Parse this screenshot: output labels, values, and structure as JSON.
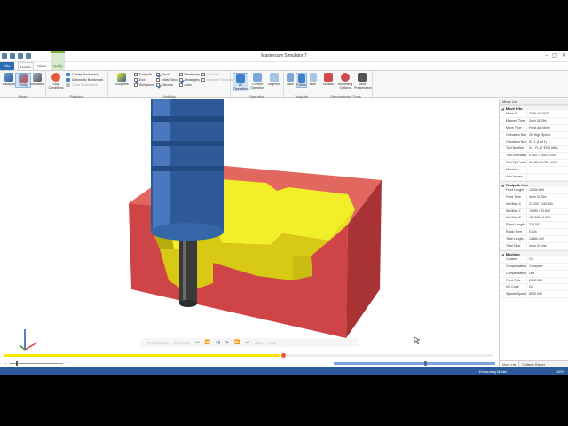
{
  "window": {
    "title": "Mastercam Simulator 7",
    "controls": [
      "–",
      "□",
      "✕"
    ]
  },
  "tabs": {
    "file": "File",
    "home": "Home",
    "view": "View",
    "verify": "Verify",
    "verify_context": "Verify"
  },
  "ribbon": {
    "mode": {
      "label": "Mode",
      "buttons": [
        {
          "name": "backplot",
          "label": "Backplot",
          "icon": "backplot-icon"
        },
        {
          "name": "verify",
          "label": "Verify",
          "icon": "verify-icon",
          "active": true
        },
        {
          "name": "simulation",
          "label": "Simulation",
          "icon": "simulation-icon"
        }
      ]
    },
    "playback": {
      "label": "Playback",
      "big_button": "Stop Conditions",
      "items": [
        "Create Bookmark",
        "Automatic Bookmark",
        "Clear Bookmarks"
      ]
    },
    "visibility": {
      "label": "Visibility",
      "big_button": "Toolpaths",
      "checks": [
        {
          "label": "Toolpath",
          "checked": false
        },
        {
          "label": "Tool",
          "checked": true
        },
        {
          "label": "Workpiece",
          "checked": false
        },
        {
          "label": "Stock",
          "checked": true
        },
        {
          "label": "Initial Stock",
          "checked": false
        },
        {
          "label": "Fixtures",
          "checked": true
        },
        {
          "label": "Wireframe",
          "checked": false
        },
        {
          "label": "Strategies",
          "checked": true
        },
        {
          "label": "Axes",
          "checked": false
        },
        {
          "label": "Machine",
          "checked": false,
          "dim": true
        },
        {
          "label": "Machine Housing",
          "checked": false,
          "dim": true
        }
      ]
    },
    "operation": {
      "label": "Operation",
      "buttons": [
        {
          "label": "All Operations",
          "active": true
        },
        {
          "label": "Current Operation"
        },
        {
          "label": "Segment"
        }
      ]
    },
    "toolpath": {
      "label": "Toolpath",
      "buttons": [
        {
          "label": "Trace"
        },
        {
          "label": "Follow",
          "active": true
        },
        {
          "label": "Both"
        }
      ]
    },
    "demonstrator": {
      "label": "Demonstrator Tools",
      "buttons": [
        {
          "label": "Session"
        },
        {
          "label": "Recording Options"
        },
        {
          "label": "Save Presentation"
        }
      ]
    }
  },
  "playback_overlay": {
    "buttons": [
      "Performance",
      "Precision",
      "⏮",
      "⏪",
      "▮▮",
      "▶",
      "⏩",
      "⏭",
      "Step",
      "Fast"
    ]
  },
  "progress": {
    "fraction": 0.57
  },
  "controls": {
    "slow": "—",
    "fast": "+"
  },
  "status": {
    "mode": "Enhancing Model",
    "percent": "100%"
  },
  "colors": {
    "stock": "#d04a4c",
    "machined": "#f2ee2a",
    "tool_holder": "#2f5a9a",
    "tool_shank": "#3a3a3a",
    "progress_fill": "#ffe600",
    "status_bar": "#2d5a9c"
  },
  "panel": {
    "title": "Move List",
    "sections": [
      {
        "title": "Move Info",
        "rows": [
          {
            "k": "Move ID",
            "v": "7296 of 10977"
          },
          {
            "k": "Elapsed Time",
            "v": "2min 36.39s"
          },
          {
            "k": "Move Type",
            "v": "Feed Arc Move"
          },
          {
            "k": "Operation Name",
            "v": "2D High Speed"
          },
          {
            "k": "Operation Numb",
            "v": "ID: 1 (1 of 1)"
          },
          {
            "k": "Tool Number",
            "v": "#1 - FLAT END MILL"
          },
          {
            "k": "Tool Orientation",
            "v": "0.000, 0.000, 1.000"
          },
          {
            "k": "Tool Tip Position",
            "v": "45.431, 5.728, -29.3"
          },
          {
            "k": "Machine",
            "v": ""
          },
          {
            "k": "Axis Values",
            "v": ""
          }
        ]
      },
      {
        "title": "Toolpath Info",
        "rows": [
          {
            "k": "Feed Length",
            "v": "12530.860"
          },
          {
            "k": "Feed Time",
            "v": "4min 33.92s"
          },
          {
            "k": "Min/Max X",
            "v": "21.200 / 135.800"
          },
          {
            "k": "Min/Max Y",
            "v": "-9.555 / 70.800"
          },
          {
            "k": "Min/Max Z",
            "v": "-29.000 / 5.000"
          },
          {
            "k": "Rapid Length",
            "v": "329.562"
          },
          {
            "k": "Rapid Time",
            "v": "0.52s"
          },
          {
            "k": "Total Length",
            "v": "12860.422"
          },
          {
            "k": "Total Time",
            "v": "4min 34.44s"
          }
        ]
      },
      {
        "title": "Machine",
        "rows": [
          {
            "k": "Coolant",
            "v": "On"
          },
          {
            "k": "Compensation T",
            "v": "Computer"
          },
          {
            "k": "Compensation D",
            "v": "Left"
          },
          {
            "k": "Feed Rate",
            "v": "2092.538"
          },
          {
            "k": "NC Code",
            "v": "G3"
          },
          {
            "k": "Spindle Speed",
            "v": "8992.000"
          }
        ]
      }
    ],
    "tabs": [
      "Move List",
      "Collision Report"
    ]
  }
}
